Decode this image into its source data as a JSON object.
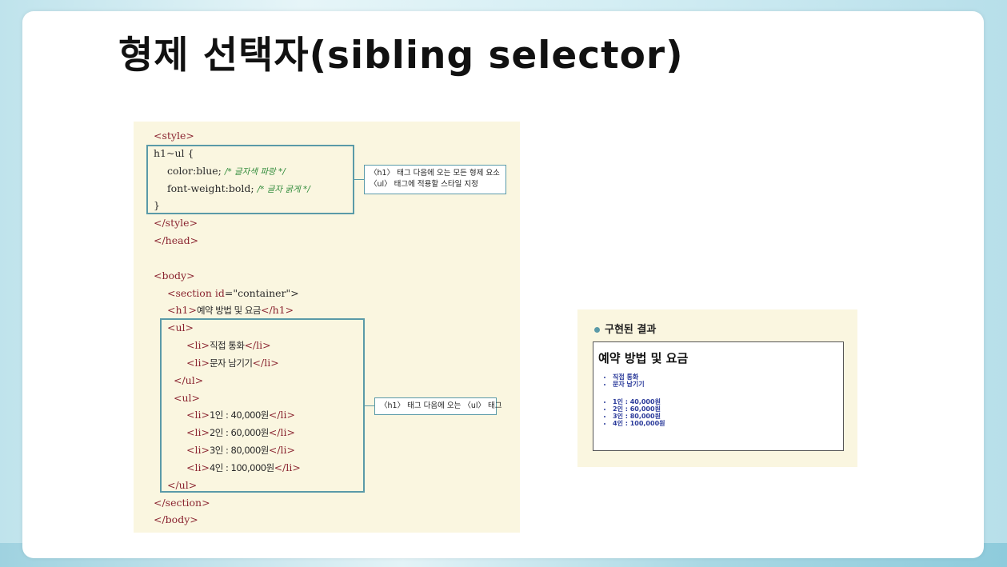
{
  "title": "형제 선택자(sibling selector)",
  "code": {
    "style_open": "<style>",
    "sel": "h1~ul {",
    "prop1": "color:blue;",
    "cm1": "/* 글자색 파랑 */",
    "prop2": "font-weight:bold;",
    "cm2": "/* 글자 굵게 */",
    "close_brace": "}",
    "style_close": "</style>",
    "head_close": "</head>",
    "body_open": "<body>",
    "section_open_pre": "<section ",
    "section_attr": "id",
    "section_open_post": "=\"container\">",
    "h1_open": "<h1>",
    "h1_text": "예약 방법 및 요금",
    "h1_close": "</h1>",
    "ul_open": "<ul>",
    "li_open": "<li>",
    "li_close": "</li>",
    "ul_close": "</ul>",
    "items_a": [
      "직접 통화",
      "문자 남기기"
    ],
    "items_b": [
      "1인 : 40,000원",
      "2인 : 60,000원",
      "3인 : 80,000원",
      "4인 : 100,000원"
    ],
    "section_close": "</section>",
    "body_close": "</body>"
  },
  "callouts": {
    "top_line1": "〈h1〉 태그 다음에 오는 모든 형제 요소",
    "top_line2": "〈ul〉 태그에 적용할 스타일 지정",
    "bottom": "〈h1〉 태그 다음에 오는 〈ul〉 태그"
  },
  "result": {
    "heading": "구현된 결과",
    "h1": "예약 방법 및 요금",
    "list_a": [
      "직접 통화",
      "문자 남기기"
    ],
    "list_b": [
      "1인 : 40,000원",
      "2인 : 60,000원",
      "3인 : 80,000원",
      "4인 : 100,000원"
    ]
  },
  "colors": {
    "accent_border": "#5a9aa8",
    "panel_bg": "#faf6e0",
    "tag": "#8a2430",
    "comment": "#2f8a3a",
    "result_text": "#2a3a9a"
  }
}
